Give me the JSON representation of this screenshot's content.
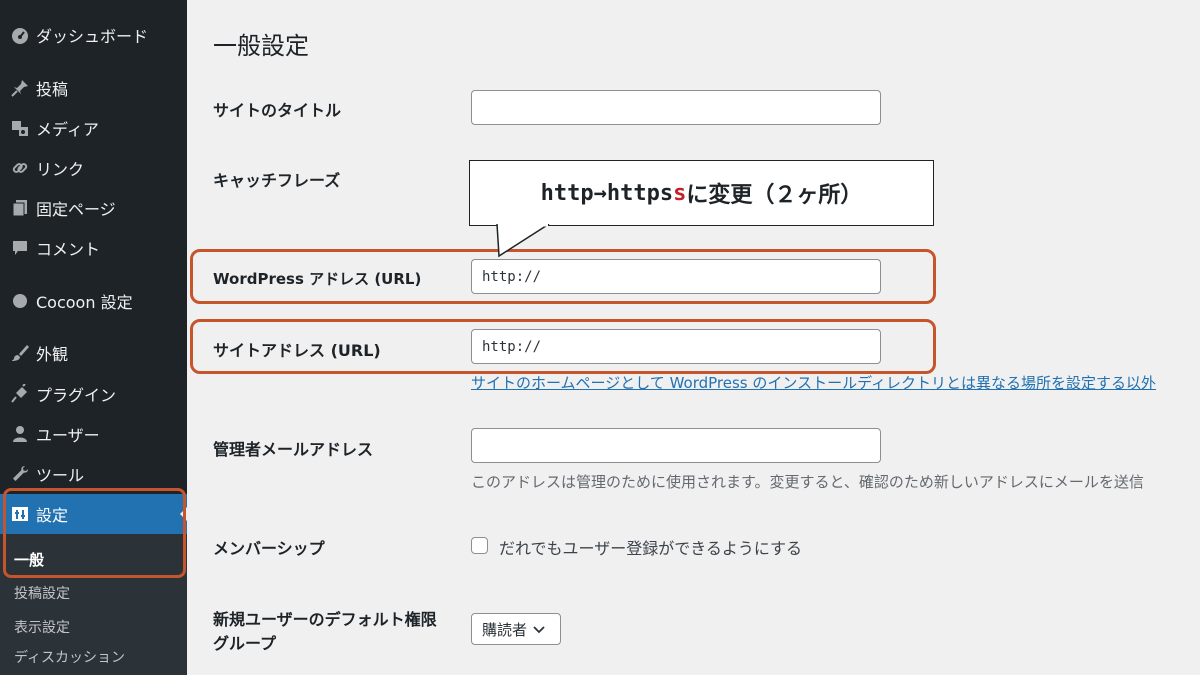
{
  "sidebar": {
    "items": [
      {
        "label": "ダッシュボード",
        "icon": "dashboard-icon"
      },
      {
        "label": "投稿",
        "icon": "pin-icon"
      },
      {
        "label": "メディア",
        "icon": "media-icon"
      },
      {
        "label": "リンク",
        "icon": "link-icon"
      },
      {
        "label": "固定ページ",
        "icon": "page-icon"
      },
      {
        "label": "コメント",
        "icon": "comment-icon"
      },
      {
        "label": "Cocoon 設定",
        "icon": "circle-icon"
      },
      {
        "label": "外観",
        "icon": "brush-icon"
      },
      {
        "label": "プラグイン",
        "icon": "plugin-icon"
      },
      {
        "label": "ユーザー",
        "icon": "user-icon"
      },
      {
        "label": "ツール",
        "icon": "wrench-icon"
      },
      {
        "label": "設定",
        "icon": "settings-icon"
      }
    ],
    "submenu": [
      "一般",
      "投稿設定",
      "表示設定",
      "ディスカッション"
    ]
  },
  "main": {
    "title": "一般設定",
    "site_title_label": "サイトのタイトル",
    "site_title_value": "",
    "tagline_label": "キャッチフレーズ",
    "wp_address_label": "WordPress アドレス (URL)",
    "wp_address_value": "http://",
    "site_address_label": "サイトアドレス (URL)",
    "site_address_value": "http://",
    "site_address_desc": "サイトのホームページとして WordPress のインストールディレクトリとは異なる場所を設定する以外",
    "admin_email_label": "管理者メールアドレス",
    "admin_email_value": "",
    "admin_email_desc": "このアドレスは管理のために使用されます。変更すると、確認のため新しいアドレスにメールを送信",
    "membership_label": "メンバーシップ",
    "membership_checkbox_label": "だれでもユーザー登録ができるようにする",
    "default_role_label_1": "新規ユーザーのデフォルト権限",
    "default_role_label_2": "グループ",
    "default_role_value": "購読者"
  },
  "callout": {
    "prefix": "http→https",
    "accent": "s",
    "suffix": "に変更（２ヶ所）"
  },
  "colors": {
    "sidebar_bg": "#1d2327",
    "active_bg": "#2271b1",
    "highlight": "#c4552d",
    "accent_red": "#c4202a"
  }
}
